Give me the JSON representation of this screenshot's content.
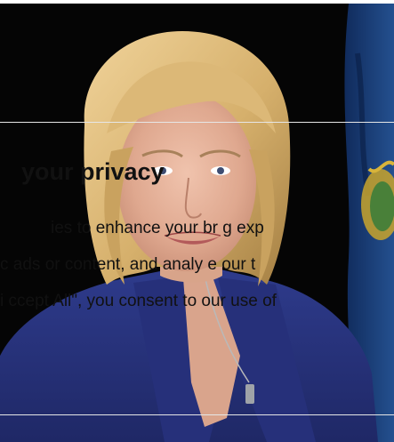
{
  "banner": {
    "title": "your privacy",
    "line1": "ies to enhance your br          g exp",
    "line2": "c        ads or content, and analy  e our t",
    "line3": "i     ccept All\", you consent to our use of"
  },
  "colors": {
    "background": "#050505",
    "jacket": "#25327a",
    "hair": "#d7b57a",
    "skin": "#e4b49e",
    "flag_blue": "#1f3d7a",
    "flag_gold": "#c9a42c"
  },
  "icons": {
    "photo": "portrait-photo"
  }
}
